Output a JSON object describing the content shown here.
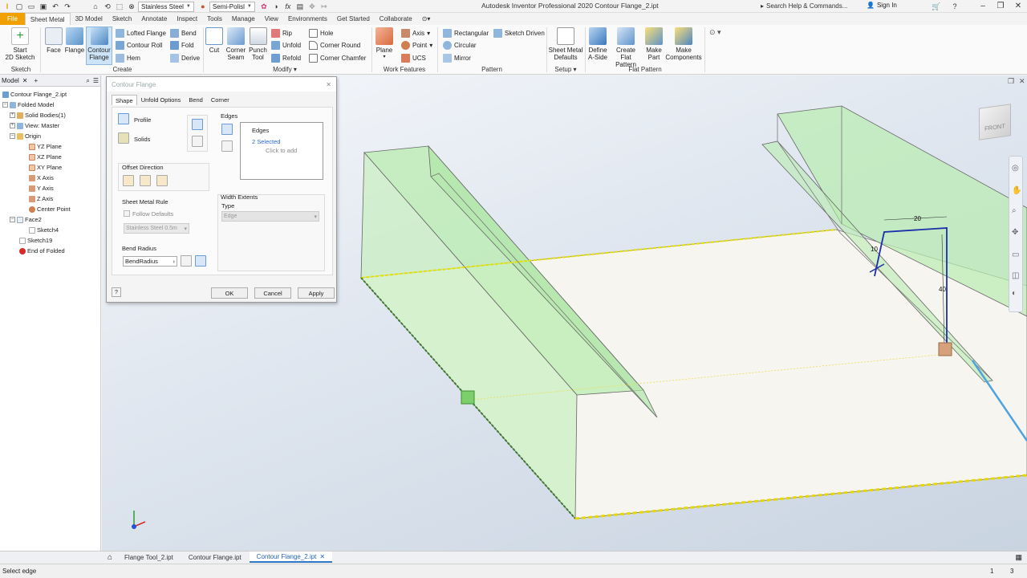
{
  "app": {
    "title": "Autodesk Inventor Professional 2020   Contour Flange_2.ipt",
    "material": "Stainless Steel",
    "appearance": "Semi-Polisl",
    "search_placeholder": "Search Help & Commands...",
    "sign_in": "Sign In"
  },
  "menu_tabs": [
    {
      "label": "File"
    },
    {
      "label": "Sheet Metal"
    },
    {
      "label": "3D Model"
    },
    {
      "label": "Sketch"
    },
    {
      "label": "Annotate"
    },
    {
      "label": "Inspect"
    },
    {
      "label": "Tools"
    },
    {
      "label": "Manage"
    },
    {
      "label": "View"
    },
    {
      "label": "Environments"
    },
    {
      "label": "Get Started"
    },
    {
      "label": "Collaborate"
    }
  ],
  "ribbon": {
    "sketch": {
      "start_line1": "Start",
      "start_line2": "2D Sketch",
      "group": "Sketch"
    },
    "create": {
      "face": "Face",
      "flange": "Flange",
      "contour_line1": "Contour",
      "contour_line2": "Flange",
      "lofted_flange": "Lofted Flange",
      "contour_roll": "Contour Roll",
      "hem": "Hem",
      "bend": "Bend",
      "fold": "Fold",
      "derive": "Derive",
      "group": "Create"
    },
    "modify": {
      "cut": "Cut",
      "corner_line1": "Corner",
      "corner_line2": "Seam",
      "punch_line1": "Punch",
      "punch_line2": "Tool",
      "rip": "Rip",
      "unfold": "Unfold",
      "refold": "Refold",
      "hole": "Hole",
      "corner_round": "Corner Round",
      "corner_chamfer": "Corner Chamfer",
      "group": "Modify"
    },
    "work": {
      "plane": "Plane",
      "axis": "Axis",
      "point": "Point",
      "ucs": "UCS",
      "group": "Work Features"
    },
    "pattern": {
      "rectangular": "Rectangular",
      "circular": "Circular",
      "mirror": "Mirror",
      "sketch_driven": "Sketch Driven",
      "group": "Pattern"
    },
    "setup": {
      "smd_line1": "Sheet Metal",
      "smd_line2": "Defaults",
      "group": "Setup"
    },
    "flat": {
      "define_line1": "Define",
      "define_line2": "A-Side",
      "create_line1": "Create",
      "create_line2": "Flat Pattern",
      "make_part_line1": "Make",
      "make_part_line2": "Part",
      "make_comp_line1": "Make",
      "make_comp_line2": "Components",
      "group": "Flat Pattern"
    }
  },
  "browser": {
    "tab": "Model",
    "nodes": [
      {
        "label": "Contour Flange_2.ipt"
      },
      {
        "label": "Folded Model"
      },
      {
        "label": "Solid Bodies(1)"
      },
      {
        "label": "View: Master"
      },
      {
        "label": "Origin"
      },
      {
        "label": "YZ Plane"
      },
      {
        "label": "XZ Plane"
      },
      {
        "label": "XY Plane"
      },
      {
        "label": "X Axis"
      },
      {
        "label": "Y Axis"
      },
      {
        "label": "Z Axis"
      },
      {
        "label": "Center Point"
      },
      {
        "label": "Face2"
      },
      {
        "label": "Sketch4"
      },
      {
        "label": "Sketch19"
      },
      {
        "label": "End of Folded"
      }
    ]
  },
  "dialog": {
    "title": "Contour Flange",
    "tabs": [
      {
        "label": "Shape"
      },
      {
        "label": "Unfold Options"
      },
      {
        "label": "Bend"
      },
      {
        "label": "Corner"
      }
    ],
    "profile": "Profile",
    "solids": "Solids",
    "offset_direction": "Offset Direction",
    "sheet_metal_rule": "Sheet Metal Rule",
    "follow_defaults": "Follow Defaults",
    "rule_value": "Stainless Steel 0.5m",
    "bend_radius": "Bend Radius",
    "bend_radius_value": "BendRadius",
    "edges_label": "Edges",
    "edges_header": "Edges",
    "edges_selected": "2 Selected",
    "edges_click": "Click to add",
    "width_extents": "Width Extents",
    "type_label": "Type",
    "type_value": "Edge",
    "ok": "OK",
    "cancel": "Cancel",
    "apply": "Apply"
  },
  "viewport": {
    "viewcube": "FRONT",
    "dims": {
      "d20": "20",
      "d10": "10",
      "d40": "40"
    },
    "colors": {
      "flange": "#b9ecb0",
      "selected_edge": "#e8e000",
      "sketch": "#1a2fa8"
    }
  },
  "doc_tabs": [
    {
      "label": "Flange Tool_2.ipt"
    },
    {
      "label": "Contour Flange.ipt"
    },
    {
      "label": "Contour Flange_2.ipt"
    }
  ],
  "status": {
    "text": "Select edge",
    "n1": "1",
    "n2": "3"
  }
}
